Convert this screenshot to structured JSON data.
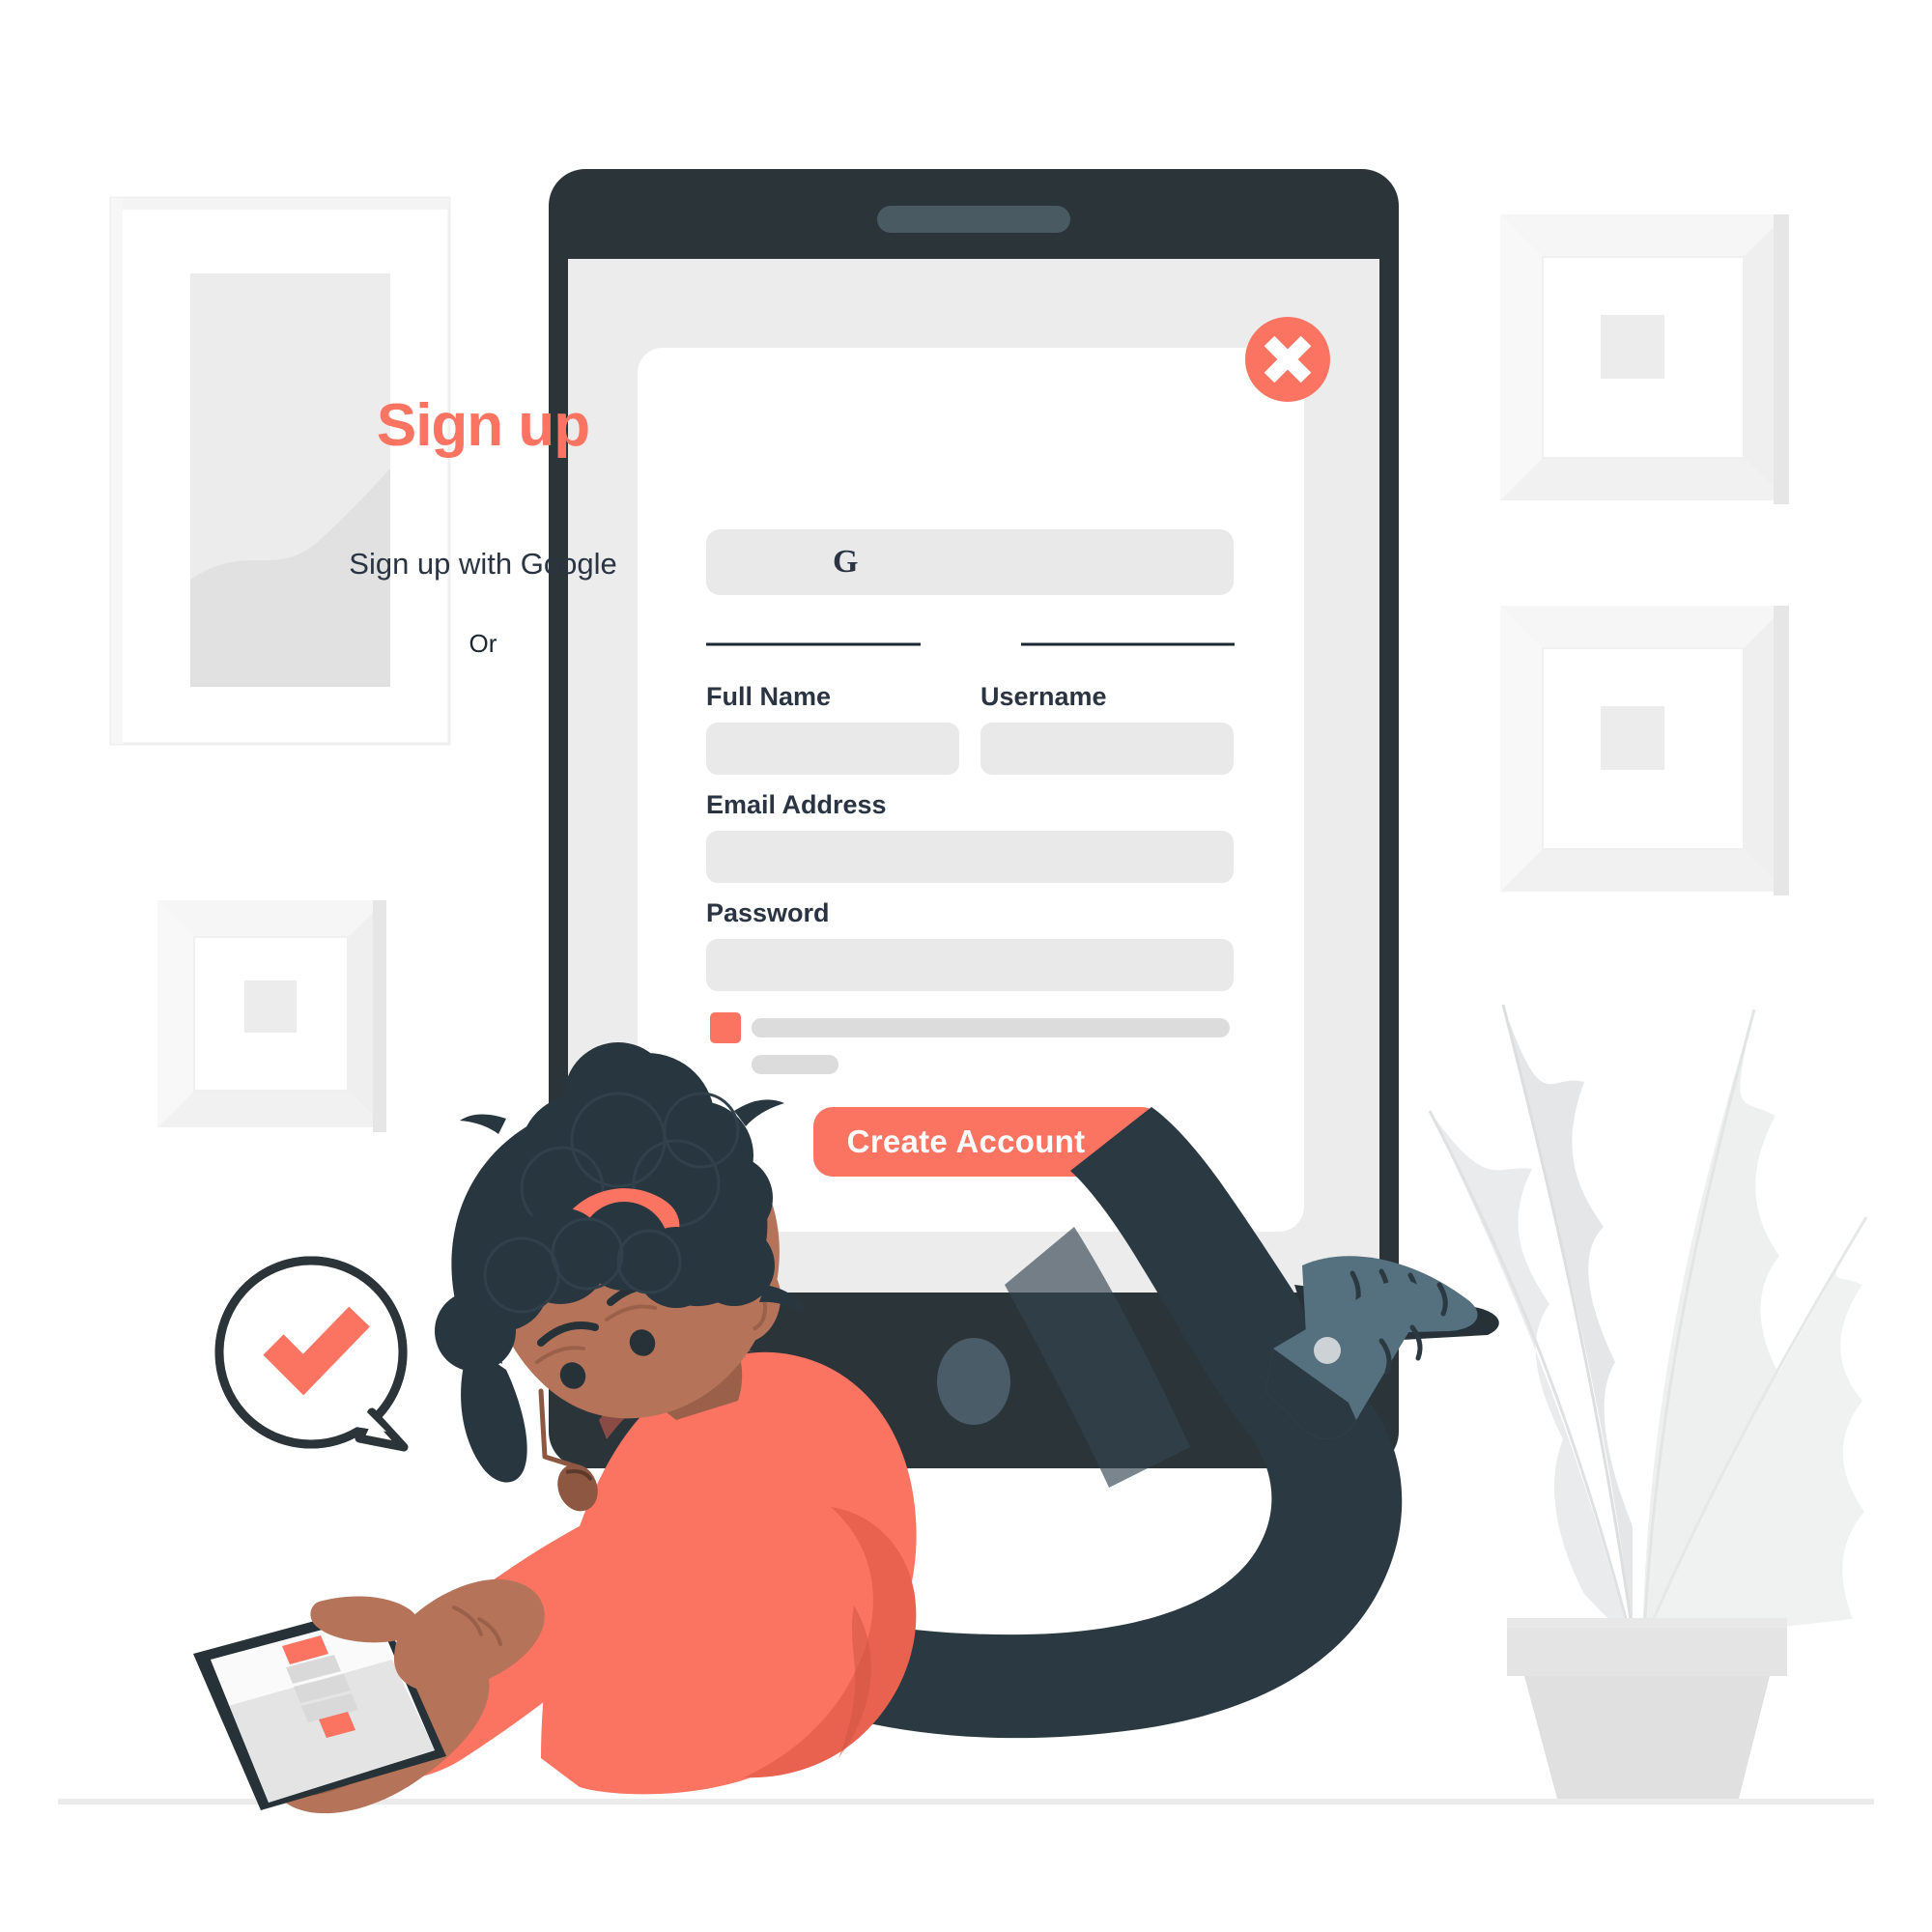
{
  "scene": {
    "description": "Sign up form illustration",
    "background_color": "#ffffff",
    "floor_line_color": "#e8e8e8"
  },
  "device": {
    "name": "tablet",
    "frame_color": "#2b3539",
    "screen_bg": "#ececec",
    "speaker_color": "#4a5a63",
    "home_button_color": "#4a5c68"
  },
  "card": {
    "background": "#ffffff",
    "close_button": {
      "label": "✕",
      "icon": "close-icon",
      "color": "#fb7361",
      "glyph_color": "#ffffff"
    },
    "title": "Sign up",
    "title_color": "#fb7361",
    "social": {
      "icon": "google-g-icon",
      "icon_glyph": "G",
      "label": "Sign up with Google",
      "background": "#e9e9e9",
      "text_color": "#2b3442"
    },
    "divider_label": "Or",
    "fields": [
      {
        "label": "Full Name",
        "value": "",
        "placeholder": "",
        "name": "full-name"
      },
      {
        "label": "Username",
        "value": "",
        "placeholder": "",
        "name": "username"
      },
      {
        "label": "Email Address",
        "value": "",
        "placeholder": "",
        "name": "email-address"
      },
      {
        "label": "Password",
        "value": "",
        "placeholder": "",
        "name": "password"
      }
    ],
    "field_bg": "#e9e9e9",
    "terms": {
      "checkbox_checked": true,
      "checkbox_color": "#fb7361",
      "line_color": "#dcdcdc"
    },
    "submit": {
      "label": "Create Account",
      "background": "#fb7361",
      "text_color": "#ffffff"
    }
  },
  "decor": {
    "wall_frames": [
      {
        "name": "frame-large-left",
        "kind": "portrait-wave",
        "border": "#ffffff",
        "mat": "#ececec"
      },
      {
        "name": "frame-small-left",
        "kind": "square-beveled",
        "border": "#fafafa",
        "mat": "#ffffff",
        "art": "#ececec"
      },
      {
        "name": "frame-top-right",
        "kind": "square-beveled",
        "border": "#fafafa",
        "mat": "#ffffff",
        "art": "#ececec"
      },
      {
        "name": "frame-bottom-right",
        "kind": "square-beveled",
        "border": "#fafafa",
        "mat": "#ffffff",
        "art": "#ececec"
      }
    ],
    "speech_bubble": {
      "name": "success-speech-bubble",
      "icon": "check-icon",
      "bubble_fill": "#ffffff",
      "bubble_stroke": "#2b3539",
      "check_color": "#fb7361"
    },
    "plant": {
      "name": "potted-plant",
      "leaf_color": "#e6e8e9",
      "leaf_color_alt": "#eeefef",
      "pot_color": "#e0e0e0",
      "pot_rim_color": "#e4e4e4"
    }
  },
  "character": {
    "name": "person-lying-with-tablet",
    "skin": "#b5745a",
    "skin_shadow": "#9b6049",
    "hair": "#283640",
    "hair_tie_color": "#fb7361",
    "shirt": "#fb7361",
    "shirt_shadow": "#e8624f",
    "pants": "#2b3a42",
    "shoe": "#55707e",
    "handheld_device": {
      "name": "handheld-tablet",
      "frame": "#263238",
      "screen": "#ffffff",
      "accent_bars": "#fb7361",
      "gray_bars": "#d7d7d7"
    }
  }
}
